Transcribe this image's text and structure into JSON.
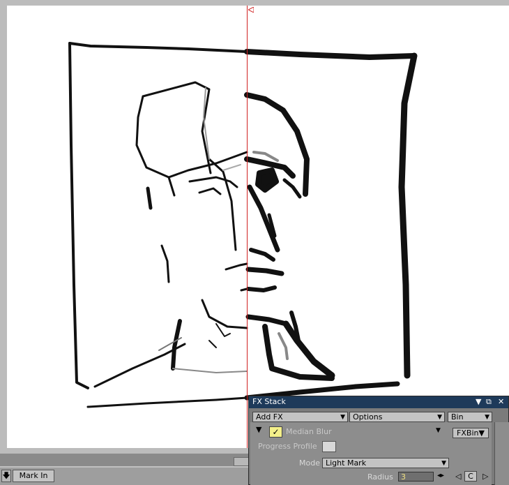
{
  "fx_stack": {
    "title": "FX Stack",
    "controls": {
      "menu": "▼",
      "restore": "⧉",
      "close": "✕"
    },
    "toolbar": {
      "add_fx": "Add FX",
      "options": "Options",
      "bin": "Bin"
    },
    "effect": {
      "name": "Median Blur",
      "enabled_mark": "✓",
      "progress_label": "Progress Profile",
      "mode_label": "Mode",
      "mode_value": "Light Mark",
      "radius_label": "Radius",
      "radius_value": "3",
      "fxbin_label": "FXBin",
      "c_label": "C"
    }
  },
  "timeline": {
    "mark_in_label": "Mark In",
    "down_arrow": "🡇"
  },
  "colors": {
    "title_bar": "#1e3a5a",
    "split_line": "#d02020",
    "checkbox": "#f4f08a"
  }
}
